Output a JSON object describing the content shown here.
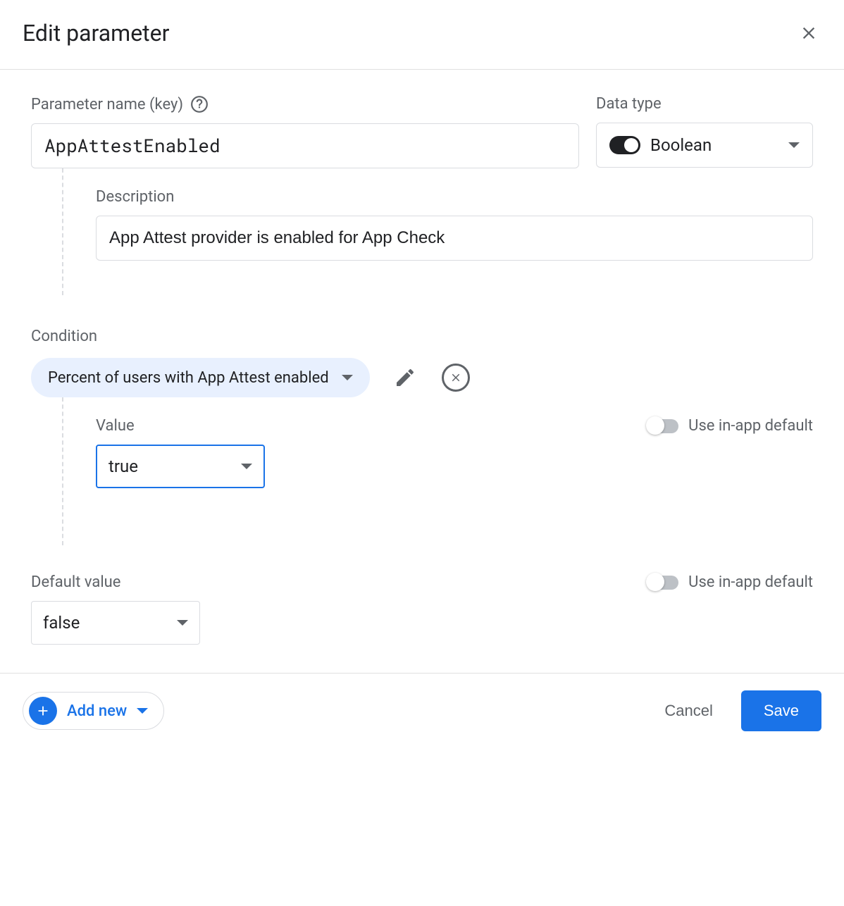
{
  "header": {
    "title": "Edit parameter"
  },
  "param": {
    "name_label": "Parameter name (key)",
    "name_value": "AppAttestEnabled",
    "type_label": "Data type",
    "type_value": "Boolean"
  },
  "description": {
    "label": "Description",
    "value": "App Attest provider is enabled for App Check"
  },
  "condition": {
    "section_label": "Condition",
    "chip_label": "Percent of users with App Attest enabled",
    "value_label": "Value",
    "value_selected": "true",
    "use_default_label": "Use in-app default"
  },
  "default": {
    "label": "Default value",
    "selected": "false",
    "use_default_label": "Use in-app default"
  },
  "footer": {
    "add_new": "Add new",
    "cancel": "Cancel",
    "save": "Save"
  }
}
